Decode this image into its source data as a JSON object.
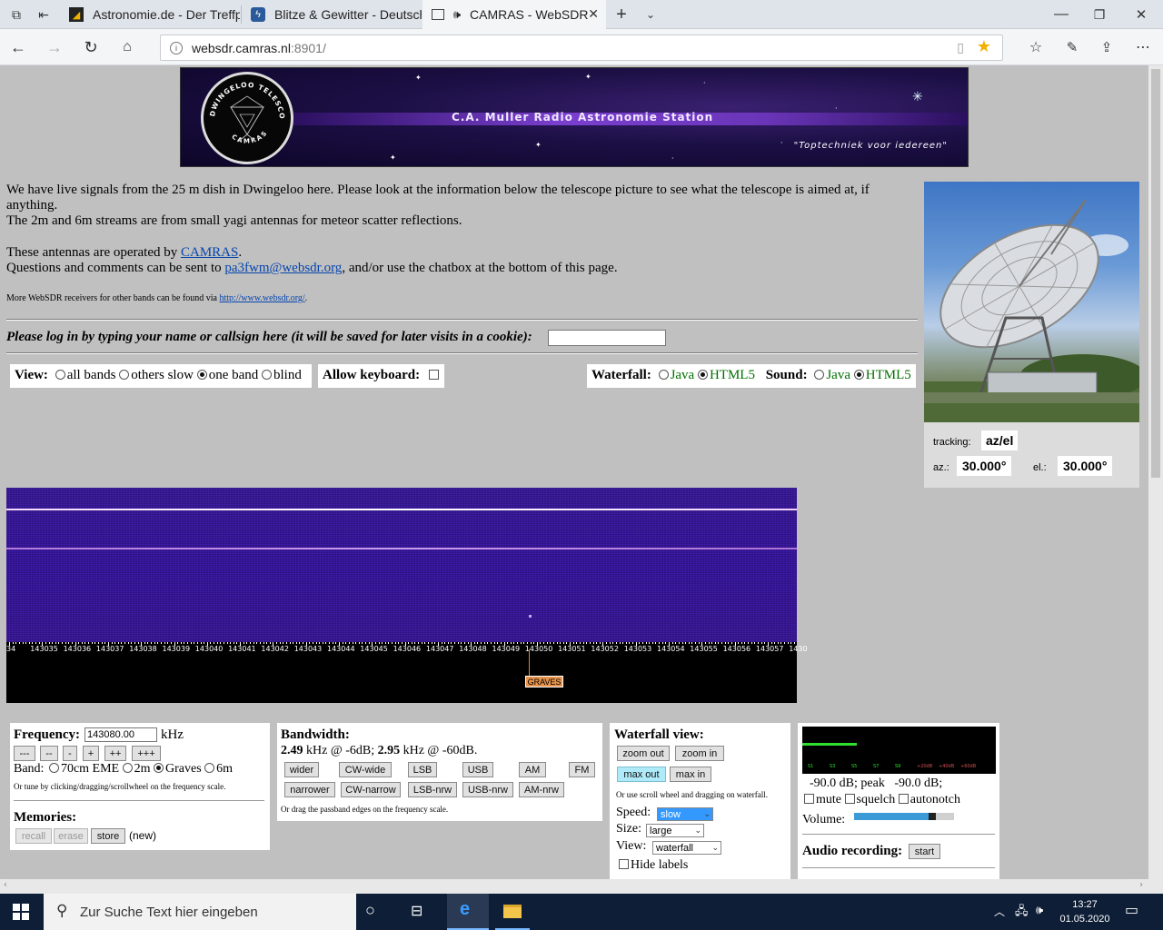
{
  "browser": {
    "tabs": [
      {
        "title": "Astronomie.de - Der Treffpu",
        "icon": "astronomie-favicon"
      },
      {
        "title": "Blitze & Gewitter - Deutschl",
        "icon": "blitzortung-favicon"
      },
      {
        "title": "CAMRAS - WebSDR",
        "icon": "page-favicon",
        "active": true
      }
    ],
    "url_host": "websdr.camras.nl",
    "url_port": ":8901/"
  },
  "banner": {
    "title": "C.A. Muller Radio Astronomie Station",
    "slogan": "\"Toptechniek voor iedereen\"",
    "logo_top": "DWINGELOO  TELESCOOP",
    "logo_bottom": "CAMRAS"
  },
  "intro": {
    "line1": "We have live signals from the 25 m dish in Dwingeloo here. Please look at the information below the telescope picture to see what the telescope is aimed at, if anything.",
    "line2": "The 2m and 6m streams are from small yagi antennas for meteor scatter reflections.",
    "operated_prefix": "These antennas are operated by ",
    "operated_link": "CAMRAS",
    "operated_suffix": ".",
    "questions_prefix": "Questions and comments can be sent to ",
    "questions_link": "pa3fwm@websdr.org",
    "questions_suffix": ", and/or use the chatbox at the bottom of this page.",
    "more_prefix": "More WebSDR receivers for other bands can be found via ",
    "more_link": "http://www.websdr.org/",
    "more_suffix": "."
  },
  "login": {
    "label": "Please log in by typing your name or callsign here (it will be saved for later visits in a cookie):",
    "value": ""
  },
  "view": {
    "label": "View:",
    "options": [
      "all bands",
      "others slow",
      "one band",
      "blind"
    ],
    "selected": "one band"
  },
  "keyboard": {
    "label": "Allow keyboard:",
    "checked": false
  },
  "waterfall_opts": {
    "label": "Waterfall:",
    "options": [
      "Java",
      "HTML5"
    ],
    "selected": "HTML5"
  },
  "sound_opts": {
    "label": "Sound:",
    "options": [
      "Java",
      "HTML5"
    ],
    "selected": "HTML5"
  },
  "telescope": {
    "tracking_label": "tracking:",
    "tracking_value": "az/el",
    "az_label": "az.:",
    "az_value": "30.000°",
    "el_label": "el.:",
    "el_value": "30.000°"
  },
  "scale": {
    "labels": [
      "34",
      "143035",
      "143036",
      "143037",
      "143038",
      "143039",
      "143040",
      "143041",
      "143042",
      "143043",
      "143044",
      "143045",
      "143046",
      "143047",
      "143048",
      "143049",
      "143050",
      "143051",
      "143052",
      "143053",
      "143054",
      "143055",
      "143056",
      "143057",
      "1430"
    ],
    "marker": "GRAVES"
  },
  "frequency": {
    "label": "Frequency:",
    "value": "143080.00",
    "unit": "kHz",
    "step_buttons": [
      "---",
      "--",
      "-",
      "+",
      "++",
      "+++"
    ],
    "band_label": "Band:",
    "bands": [
      "70cm EME",
      "2m",
      "Graves",
      "6m"
    ],
    "band_selected": "Graves",
    "hint": "Or tune by clicking/dragging/scrollwheel on the frequency scale."
  },
  "memories": {
    "label": "Memories:",
    "buttons": [
      "recall",
      "erase",
      "store"
    ],
    "status": "(new)"
  },
  "bandwidth": {
    "label": "Bandwidth:",
    "bw1": "2.49",
    "bw1_text": " kHz @ -6dB; ",
    "bw2": "2.95",
    "bw2_text": " kHz @ -60dB.",
    "row1": [
      "wider",
      "CW-wide",
      "LSB",
      "USB",
      "AM",
      "FM"
    ],
    "row2": [
      "narrower",
      "CW-narrow",
      "LSB-nrw",
      "USB-nrw",
      "AM-nrw"
    ],
    "hint": "Or drag the passband edges on the frequency scale."
  },
  "wfview": {
    "label": "Waterfall view:",
    "buttons": [
      "zoom out",
      "zoom in",
      "max out",
      "max in"
    ],
    "hint": "Or use scroll wheel and dragging on waterfall.",
    "speed_label": "Speed:",
    "speed_value": "slow",
    "size_label": "Size:",
    "size_value": "large",
    "view_label": "View:",
    "view_value": "waterfall",
    "hide_labels": "Hide labels"
  },
  "audio": {
    "smeter_labels": [
      "S1",
      "S3",
      "S5",
      "S7",
      "S9",
      "+20dB",
      "+40dB",
      "+60dB"
    ],
    "level_text": "-90.0 dB; peak   -90.0 dB;",
    "mute": "mute",
    "squelch": "squelch",
    "autonotch": "autonotch",
    "volume_label": "Volume:",
    "volume_level": 0.78,
    "recording_label": "Audio recording:",
    "recording_button": "start"
  },
  "taskbar": {
    "search_placeholder": "Zur Suche Text hier eingeben",
    "time": "13:27",
    "date": "01.05.2020"
  },
  "colors": {
    "page_bg": "#c0c0c0",
    "link": "#0645ad",
    "accent": "#0078d7"
  }
}
